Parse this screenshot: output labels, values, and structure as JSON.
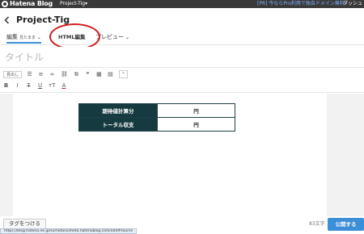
{
  "topbar": {
    "brand": "Hatena Blog",
    "blog_switcher": "Project-Tig▾",
    "promo": "[PR] 今ならPro利用で独自ドメイン無料",
    "dashboard": "ダッシュ"
  },
  "header": {
    "title": "Project-Tig"
  },
  "tabs": {
    "edit_label": "編集",
    "edit_mode": "見たまま",
    "html_label": "HTML編集",
    "preview_label": "プレビュー"
  },
  "title_input": {
    "placeholder": "タイトル"
  },
  "toolbar": {
    "format_select": "見出し"
  },
  "editor": {
    "rows": [
      {
        "label": "期待値計算分",
        "value": "円"
      },
      {
        "label": "トータル収支",
        "value": "円"
      }
    ]
  },
  "footer": {
    "tag_button": "タグをつける",
    "char_count": "83文字",
    "publish_button": "公開する",
    "status_url": "https://blog.hatena.ne.jp/sumeta/sumeta.hatenablog.com/edit#source"
  },
  "colors": {
    "topbar": "#3a3a3a",
    "accent": "#3b8ed8",
    "table_header": "#153a40",
    "annotation": "#d11c1c"
  }
}
